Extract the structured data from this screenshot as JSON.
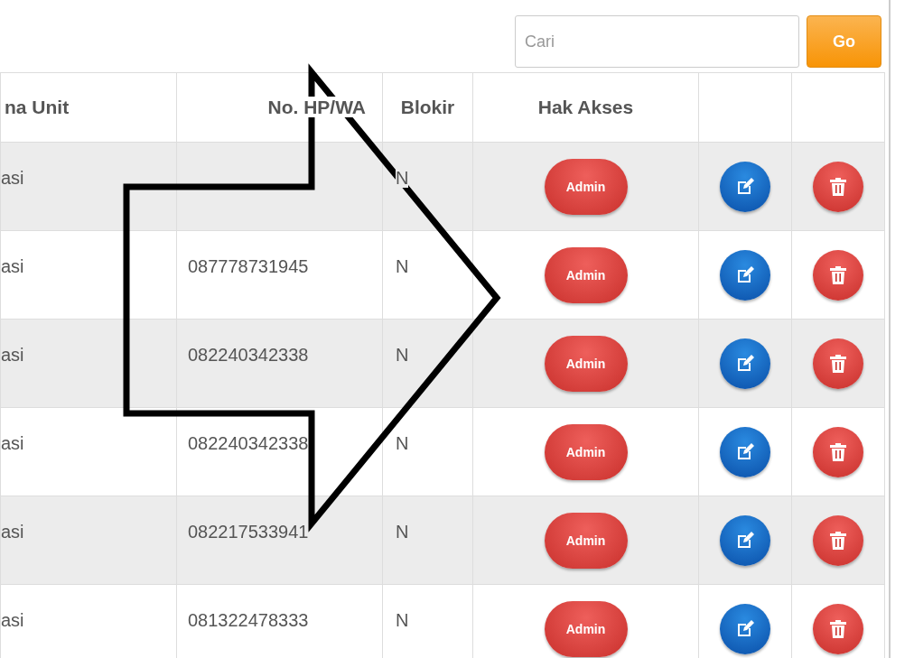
{
  "search": {
    "placeholder": "Cari",
    "button": "Go"
  },
  "table": {
    "columns": [
      "na Unit",
      "No. HP/WA",
      "Blokir",
      "Hak Akses"
    ],
    "rows": [
      {
        "unit": "asi",
        "blokir": "N",
        "access": "Admin"
      },
      {
        "unit": "asi",
        "phone": "087778731945",
        "blokir": "N",
        "access": "Admin"
      },
      {
        "unit": "asi",
        "phone": "082240342338",
        "blokir": "N",
        "access": "Admin"
      },
      {
        "unit": "asi",
        "phone": "082240342338",
        "blokir": "N",
        "access": "Admin"
      },
      {
        "unit": "asi",
        "phone": "082217533941",
        "blokir": "N",
        "access": "Admin"
      },
      {
        "unit": "asi",
        "phone": "081322478333",
        "blokir": "N",
        "access": "Admin"
      }
    ]
  }
}
